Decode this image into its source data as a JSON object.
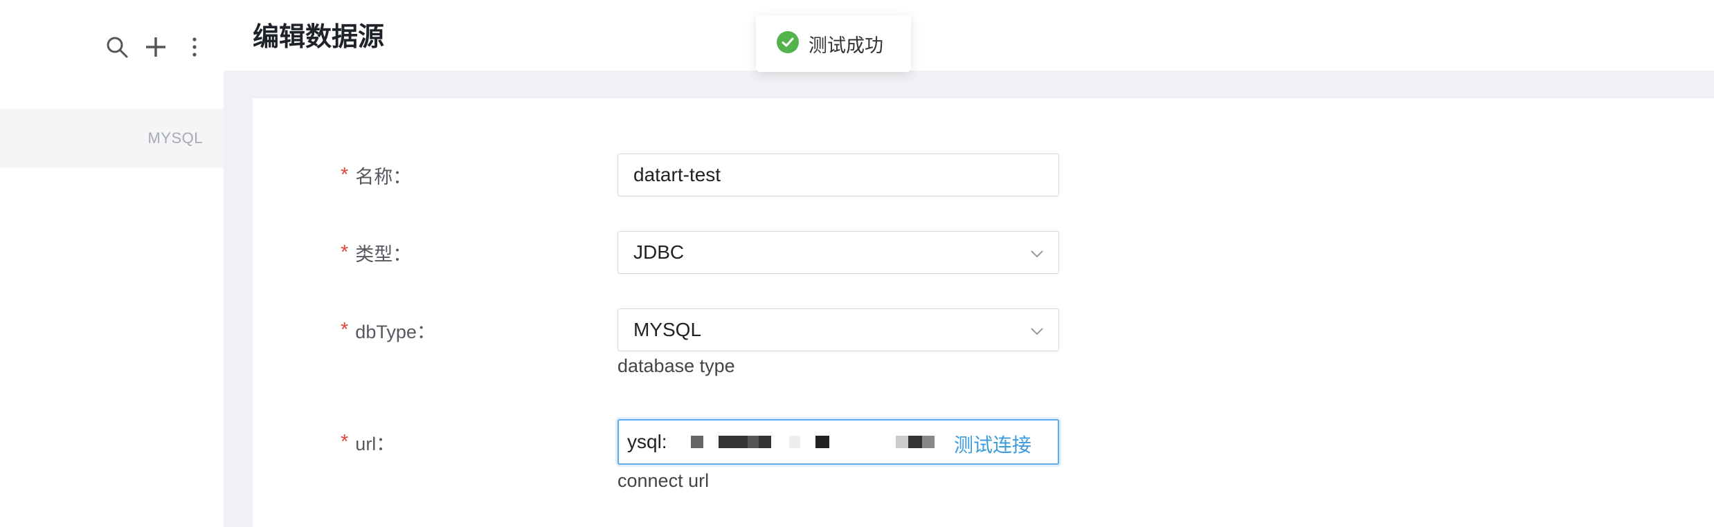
{
  "sidebar": {
    "items": [
      {
        "label": "MYSQL"
      }
    ],
    "tools": [
      "search-icon",
      "plus-icon",
      "more-vertical-icon"
    ]
  },
  "header": {
    "title": "编辑数据源"
  },
  "toast": {
    "message": "测试成功",
    "icon": "check-circle-icon",
    "color": "#52b44b"
  },
  "form": {
    "name": {
      "label": "名称：",
      "value": "datart-test",
      "required": true
    },
    "type": {
      "label": "类型：",
      "value": "JDBC",
      "required": true
    },
    "dbType": {
      "label": "dbType：",
      "value": "MYSQL",
      "help": "database type",
      "required": true
    },
    "url": {
      "label": "url：",
      "value": "ysql:/.",
      "help": "connect url",
      "action": "测试连接",
      "required": true
    }
  },
  "colors": {
    "accent": "#3e9bdc",
    "required": "#e0463a",
    "success": "#52b44b"
  }
}
